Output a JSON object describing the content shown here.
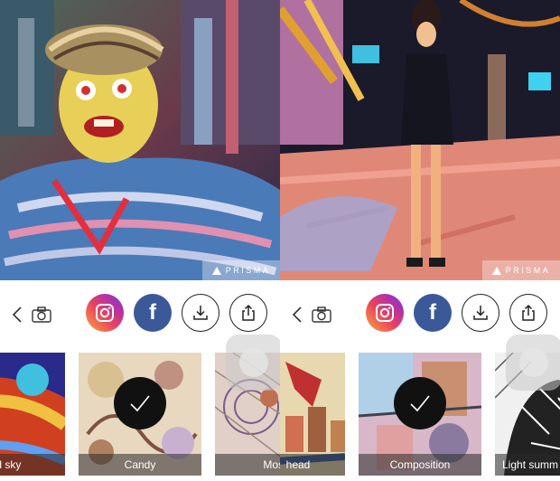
{
  "panels": [
    {
      "watermark": "PRISMA",
      "toolbar": {
        "back": "chevron-left-icon",
        "camera": "camera-icon",
        "instagram": "instagram-icon",
        "facebook_glyph": "f",
        "download": "download-icon",
        "share": "share-icon"
      },
      "filters": [
        {
          "label": "red sky",
          "selected": false
        },
        {
          "label": "Candy",
          "selected": true
        },
        {
          "label": "Mosa",
          "selected": false
        }
      ]
    },
    {
      "watermark": "PRISMA",
      "toolbar": {
        "back": "chevron-left-icon",
        "camera": "camera-icon",
        "instagram": "instagram-icon",
        "facebook_glyph": "f",
        "download": "download-icon",
        "share": "share-icon"
      },
      "filters": [
        {
          "label": "head",
          "selected": false
        },
        {
          "label": "Composition",
          "selected": true
        },
        {
          "label": "Light summ",
          "selected": false
        }
      ]
    }
  ],
  "colors": {
    "facebook": "#3b5998",
    "check_bg": "#111111",
    "label_bg": "rgba(40,40,40,0.55)"
  }
}
